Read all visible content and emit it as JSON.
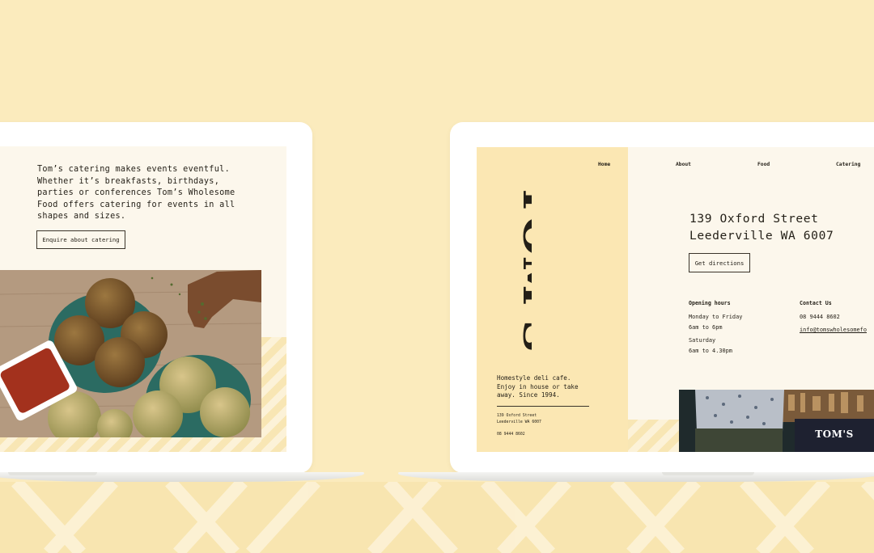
{
  "left_screen": {
    "catering_text": "Tom’s catering makes events eventful.\nWhether it’s breakfasts, birthdays,\nparties or conferences Tom’s Wholesome\nFood offers catering for events in all\nshapes and sizes.",
    "enquire_button": "Enquire about catering"
  },
  "right_screen": {
    "logo": "TOM'S",
    "tagline": "Homestyle deli cafe.\nEnjoy in house or take\naway. Since 1994.",
    "sidebar_address": "139 Oxford Street\nLeederville WA 6007",
    "sidebar_phone": "08 9444 8602",
    "nav": [
      "Home",
      "About",
      "Food",
      "Catering"
    ],
    "address": "139 Oxford Street\nLeederville WA 6007",
    "directions_button": "Get directions",
    "opening_hours": {
      "heading": "Opening hours",
      "weekdays": "Monday to Friday\n6am to 6pm",
      "saturday": "Saturday\n6am to 4.30pm"
    },
    "contact": {
      "heading": "Contact Us",
      "phone": "08 9444 8602",
      "email": "info@tomswholesomefo"
    },
    "photo_sign": "TOM'S"
  },
  "colors": {
    "background": "#fbebbd",
    "sidebar": "#fbe7b3",
    "screen": "#fcf7ec",
    "sign": "#1e2130"
  }
}
